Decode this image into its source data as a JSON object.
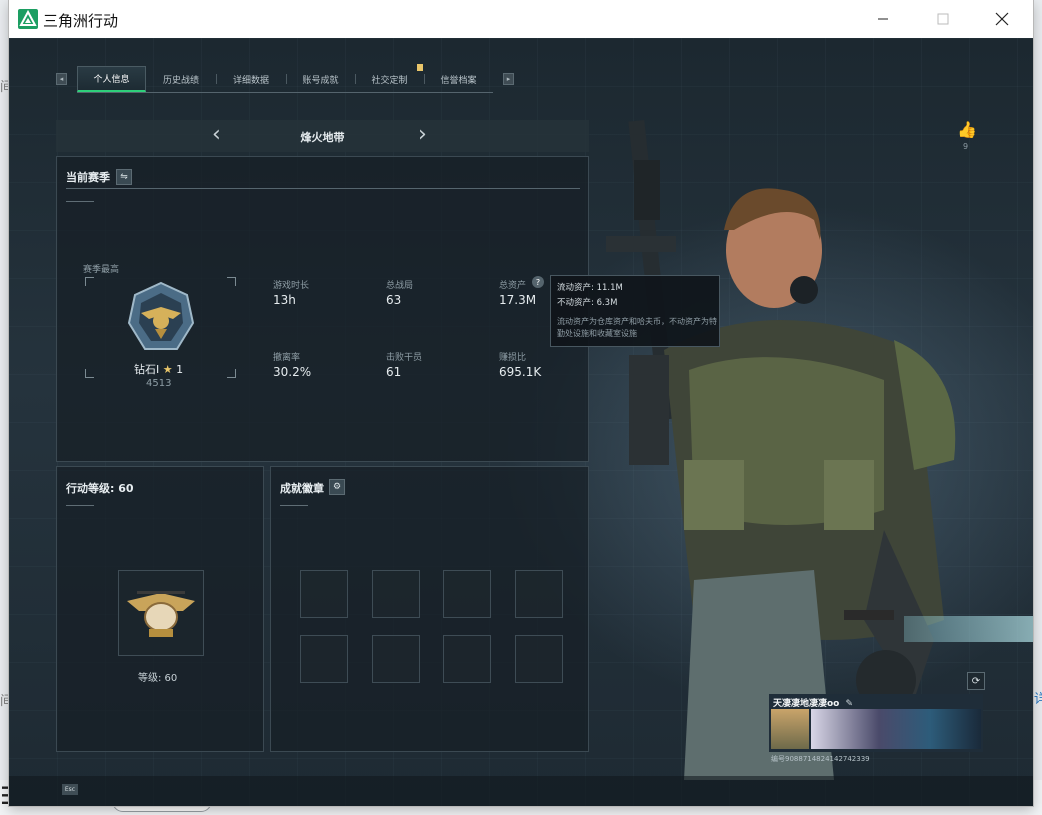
{
  "desktop": {
    "left_fragment_1": "间",
    "left_fragment_2": "间",
    "right_fragment": "详"
  },
  "window": {
    "title": "三角洲行动",
    "icon": "delta-logo-icon"
  },
  "game": {
    "top_id": "",
    "watermark": "",
    "tabs": [
      {
        "label": "个人信息",
        "active": true
      },
      {
        "label": "历史战绩",
        "active": false
      },
      {
        "label": "详细数据",
        "active": false
      },
      {
        "label": "账号成就",
        "active": false
      },
      {
        "label": "社交定制",
        "active": false
      },
      {
        "label": "信誉档案",
        "active": false
      }
    ],
    "map_selector": {
      "name": "烽火地带"
    },
    "season": {
      "title": "当前赛季",
      "best_label": "赛季最高",
      "rank_name": "钻石I",
      "rank_stars": "1",
      "rank_points": "4513",
      "stats": [
        {
          "label": "游戏时长",
          "value": "13h"
        },
        {
          "label": "总战局",
          "value": "63"
        },
        {
          "label": "总资产",
          "value": "17.3M"
        },
        {
          "label": "撤离率",
          "value": "30.2%"
        },
        {
          "label": "击败干员",
          "value": "61"
        },
        {
          "label": "赚损比",
          "value": "695.1K"
        }
      ]
    },
    "asset_tooltip": {
      "liquid": "流动资产: 11.1M",
      "fixed": "不动资产: 6.3M",
      "note": "流动资产为仓库资产和哈夫币，不动资产为特勤处设施和收藏室设施"
    },
    "action_level": {
      "title": "行动等级: 60",
      "level_text": "等级: 60"
    },
    "achievements": {
      "title": "成就徽章"
    },
    "likes": {
      "count": "9"
    },
    "player_card": {
      "name": "天凄凄地凄凄oo",
      "id_line": "编号9088714824142742339"
    },
    "footer": {
      "esc_key": "Esc",
      "esc_label": ""
    }
  },
  "colors": {
    "accent_green": "#2ecf7a",
    "panel_bg": "#161f26",
    "rank_star": "#e9c66a"
  }
}
